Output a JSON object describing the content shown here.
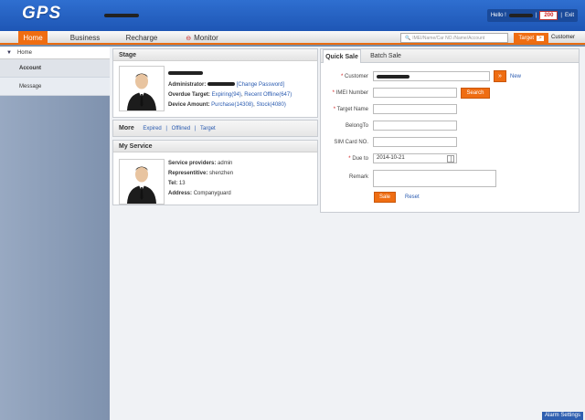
{
  "app": {
    "logo": "GPS"
  },
  "header": {
    "hello_prefix": "Hello !",
    "message_count": "200",
    "exit_label": "Exit"
  },
  "nav": {
    "items": [
      "Home",
      "Business",
      "Recharge",
      "Monitor"
    ],
    "active": "Home"
  },
  "search": {
    "placeholder": "IMEI/Name/Car NO./Name/Account"
  },
  "target_button": {
    "label": "Target",
    "arrow": ">"
  },
  "customer_label": "Customer",
  "sidebar": {
    "home": "Home",
    "items": [
      "Account",
      "Message"
    ]
  },
  "stage": {
    "title": "Stage",
    "administrator_label": "Administrator:",
    "change_password": "[Change Password]",
    "overdue_label": "Overdue Target:",
    "expiring": "Expiring(94)",
    "recent_offline": "Recent Offline(647)",
    "device_label": "Device Amount:",
    "purchase": "Purchase(14308)",
    "stock": "Stock(4080)",
    "sep": ","
  },
  "more": {
    "title": "More",
    "links": [
      "Expired",
      "Offlined",
      "Target"
    ],
    "sep": "|"
  },
  "service": {
    "title": "My Service",
    "providers_label": "Service providers:",
    "providers": "admin",
    "rep_label": "Representitive:",
    "rep": "shenzhen",
    "tel_label": "Tel:",
    "tel": "13",
    "addr_label": "Address:",
    "addr": "Companyguard"
  },
  "sale": {
    "tabs": [
      "Quick Sale",
      "Batch Sale"
    ],
    "customer_label": "Customer",
    "new_link": "New",
    "imei_label": "IMEI Number",
    "search_btn": "Search",
    "target_name_label": "Target Name",
    "belong_label": "BelongTo",
    "sim_label": "SIM Card NO.",
    "due_label": "Due to",
    "due_value": "2014-10-21",
    "remark_label": "Remark",
    "sale_btn": "Sale",
    "reset_btn": "Reset",
    "required_mark": "*"
  },
  "alarm": {
    "label": "Alarm Settings"
  },
  "colors": {
    "accent": "#ef6d12",
    "header": "#2f6fd0",
    "link": "#2a5bb0"
  }
}
